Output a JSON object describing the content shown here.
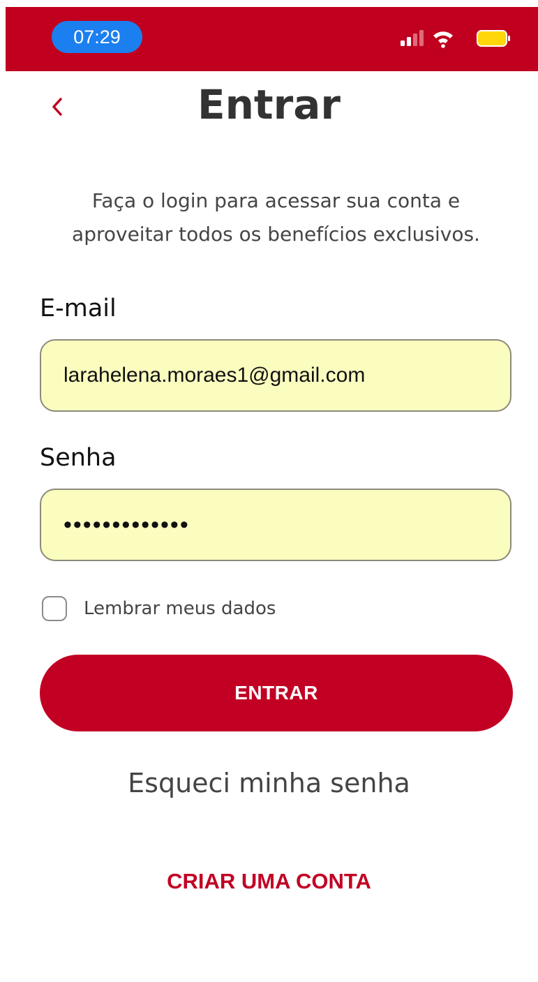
{
  "status_bar": {
    "time": "07:29",
    "icons": [
      "signal-icon",
      "wifi-icon",
      "battery-icon"
    ]
  },
  "header": {
    "back_icon": "chevron-left-icon",
    "title": "Entrar"
  },
  "subtitle": {
    "line1": "Faça o login para acessar sua conta e",
    "line2": "aproveitar todos os benefícios exclusivos."
  },
  "form": {
    "email_label": "E-mail",
    "email_value": "larahelena.moraes1@gmail.com",
    "password_label": "Senha",
    "password_value": "•••••••••••••",
    "remember_label": "Lembrar meus dados",
    "remember_checked": false,
    "submit_label": "ENTRAR"
  },
  "links": {
    "forgot": "Esqueci minha senha",
    "create": "CRIAR UMA CONTA"
  },
  "colors": {
    "brand": "#c0001e",
    "time_pill": "#1c7ff0",
    "field_bg": "#fbfdbf",
    "battery": "#ffd60a"
  }
}
